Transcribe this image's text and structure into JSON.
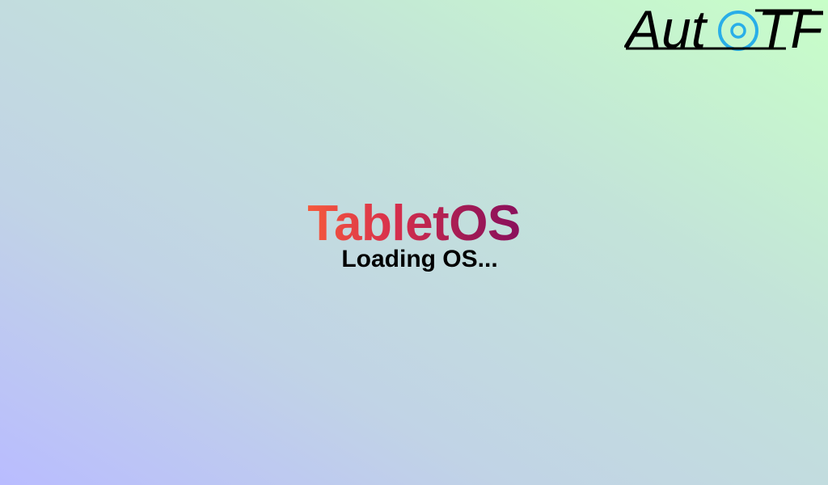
{
  "logo": {
    "text_left": "Aut",
    "text_right": "TF",
    "ring_color": "#29aee8",
    "icon": "target-ring-icon"
  },
  "splash": {
    "brand": "TabletOS",
    "status": "Loading OS...",
    "brand_gradient": [
      "#f55a3c",
      "#8a0f5c"
    ]
  },
  "background_gradient": [
    "#b9bcff",
    "#c8ffc8"
  ]
}
